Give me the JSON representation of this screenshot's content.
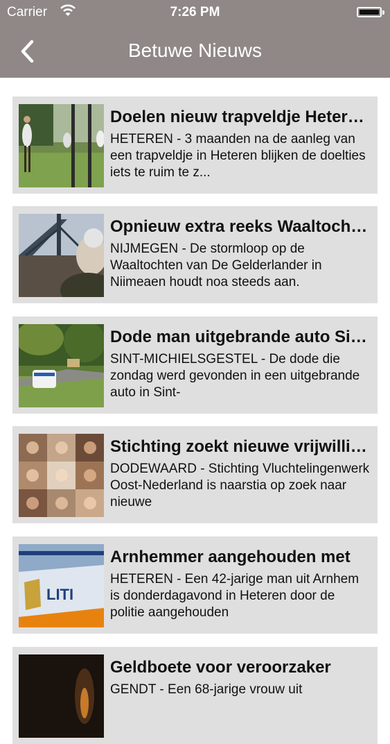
{
  "status_bar": {
    "carrier": "Carrier",
    "time": "7:26 PM"
  },
  "nav": {
    "title": "Betuwe Nieuws",
    "back_icon": "chevron-left-icon"
  },
  "articles": [
    {
      "title": "Doelen nieuw trapveldje Heteren te ruim",
      "summary": "HETEREN - 3 maanden na de aanleg van een trapveldje in Heteren blijken de doelties iets te ruim te z..."
    },
    {
      "title": "Opnieuw extra reeks Waaltochten",
      "summary": "NIJMEGEN - De stormloop op de Waaltochten van De Gelderlander in Niimeaen houdt noa steeds aan."
    },
    {
      "title": "Dode man uitgebrande auto Sint-Michielsgestel",
      "summary": "SINT-MICHIELSGESTEL - De dode die zondag werd gevonden in een uitgebrande auto in Sint-"
    },
    {
      "title": "Stichting zoekt nieuwe vrijwilligers",
      "summary": "DODEWAARD - Stichting Vluchtelingenwerk Oost-Nederland is naarstia op zoek naar nieuwe"
    },
    {
      "title": "Arnhemmer aangehouden met",
      "summary": "HETEREN - Een 42-jarige man uit Arnhem is donderdagavond in Heteren door de politie aangehouden"
    },
    {
      "title": "Geldboete voor veroorzaker",
      "summary": "GENDT - Een 68-jarige vrouw uit"
    }
  ]
}
